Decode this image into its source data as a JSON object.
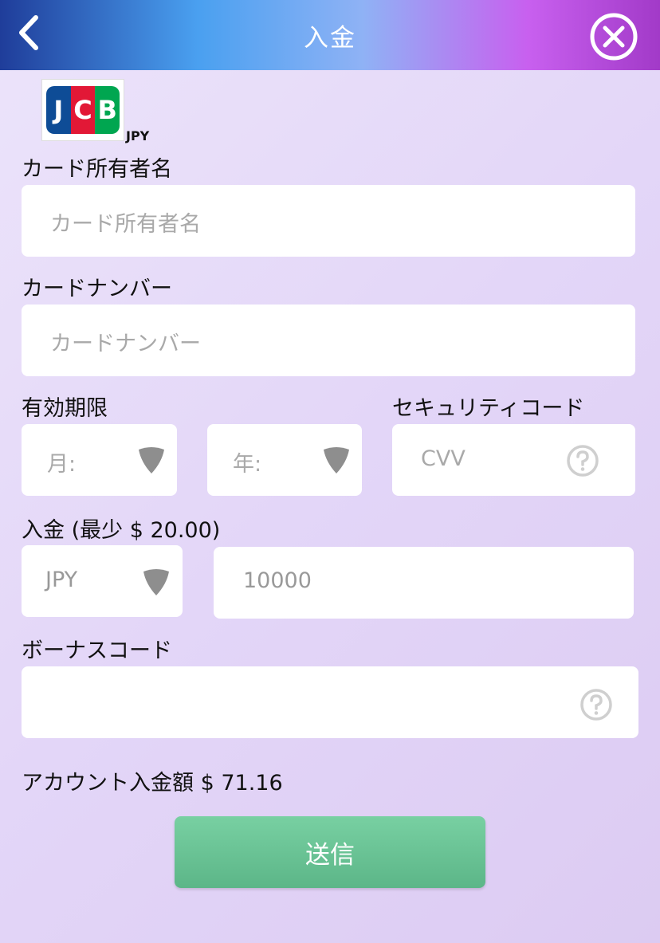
{
  "header": {
    "title": "入金"
  },
  "logo": {
    "brand": "JCB",
    "currency": "JPY"
  },
  "form": {
    "cardholder": {
      "label": "カード所有者名",
      "placeholder": "カード所有者名"
    },
    "card_number": {
      "label": "カードナンバー",
      "placeholder": "カードナンバー"
    },
    "expiry": {
      "label": "有効期限",
      "month_placeholder": "月:",
      "year_placeholder": "年:"
    },
    "security": {
      "label": "セキュリティコード",
      "placeholder": "CVV"
    },
    "deposit": {
      "label": "入金 (最少 $ 20.00)",
      "currency_selected": "JPY",
      "amount": "10000"
    },
    "bonus": {
      "label": "ボーナスコード",
      "value": ""
    }
  },
  "balance": {
    "text": "アカウント入金額 $ 71.16"
  },
  "submit": {
    "label": "送信"
  },
  "icons": {
    "back": "chevron-left-icon",
    "close": "close-circle-icon",
    "dropdown": "dropdown-arrow-icon",
    "help": "question-circle-icon"
  },
  "colors": {
    "submit_button": "#6cc496",
    "placeholder_text": "#a9a9a9",
    "field_background": "#ffffff"
  }
}
